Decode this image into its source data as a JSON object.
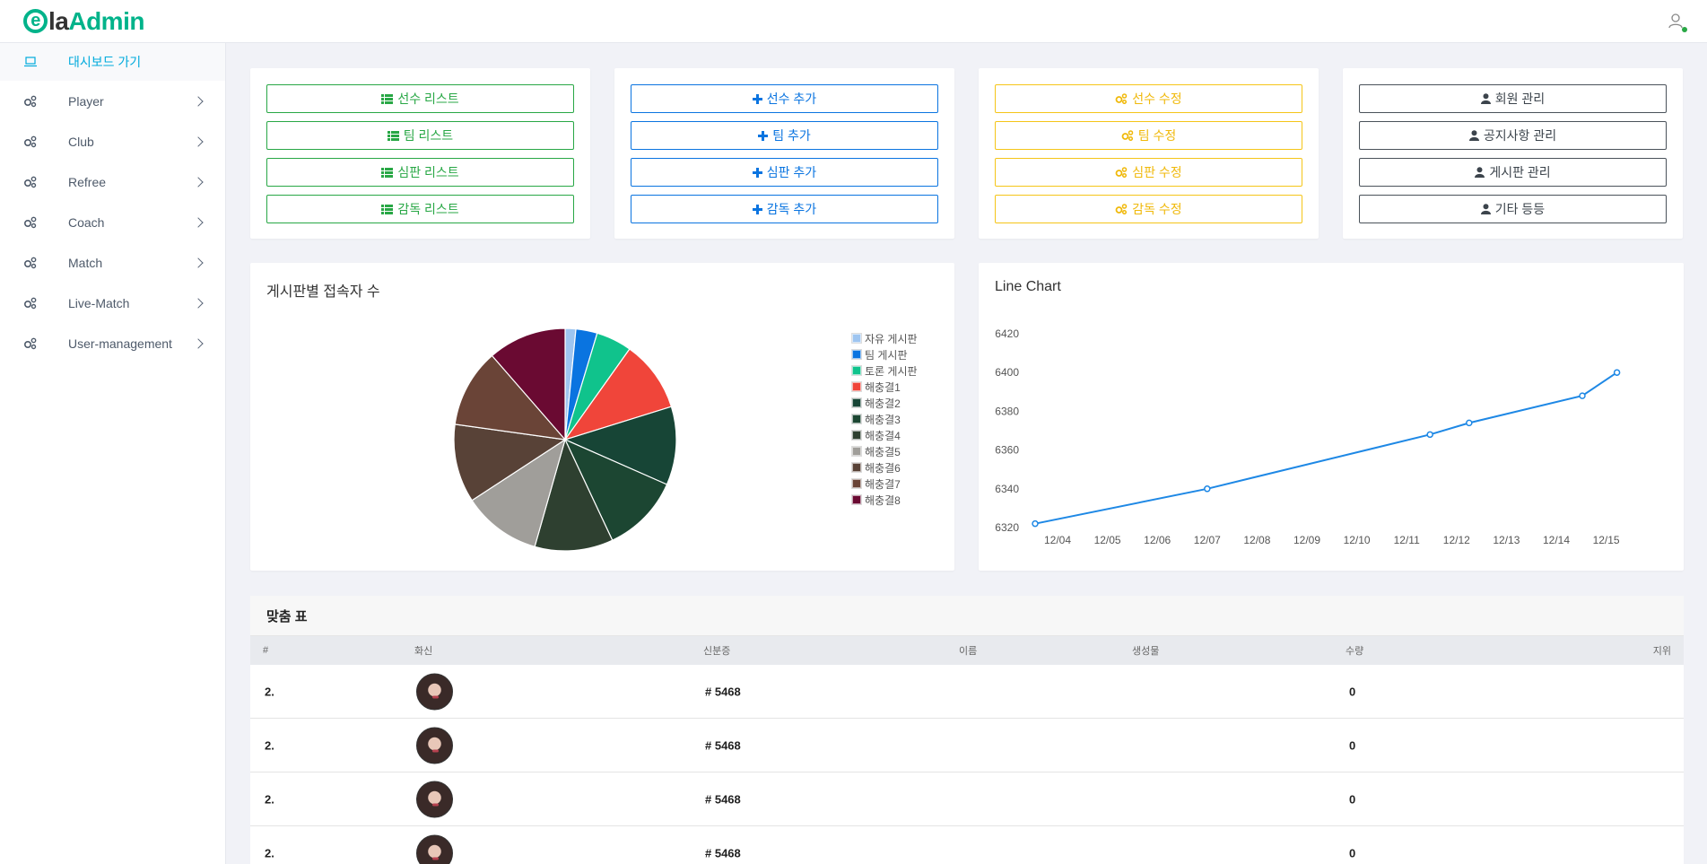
{
  "header": {
    "logo_e": "e",
    "logo_mid": "la",
    "logo_end": "Admin"
  },
  "sidebar": {
    "items": [
      {
        "label": "대시보드 가기",
        "icon": "laptop-icon"
      },
      {
        "label": "Player",
        "icon": "cogs-icon"
      },
      {
        "label": "Club",
        "icon": "cogs-icon"
      },
      {
        "label": "Refree",
        "icon": "cogs-icon"
      },
      {
        "label": "Coach",
        "icon": "cogs-icon"
      },
      {
        "label": "Match",
        "icon": "cogs-icon"
      },
      {
        "label": "Live-Match",
        "icon": "cogs-icon"
      },
      {
        "label": "User-management",
        "icon": "cogs-icon"
      }
    ]
  },
  "actions": {
    "list": [
      "선수 리스트",
      "팀 리스트",
      "심판 리스트",
      "감독 리스트"
    ],
    "add": [
      "선수 추가",
      "팀 추가",
      "심판 추가",
      "감독 추가"
    ],
    "edit": [
      "선수 수정",
      "팀 수정",
      "심판 수정",
      "감독 수정"
    ],
    "manage": [
      "회원 관리",
      "공지사항 관리",
      "게시판 관리",
      "기타 등등"
    ]
  },
  "colors": {
    "green": "#28a745",
    "blue": "#0a74e0",
    "yellow": "#f0b90b",
    "dark": "#3c444c",
    "brand": "#00b38a",
    "line": "#1e88e5"
  },
  "chart_data": [
    {
      "type": "pie",
      "title": "게시판별 접속자 수",
      "categories": [
        "자유 게시판",
        "팀 게시판",
        "토론 게시판",
        "해충결1",
        "해충결2",
        "해충결3",
        "해충결4",
        "해충결5",
        "해충결6",
        "해충결7",
        "해충결8"
      ],
      "values": [
        1.5,
        3,
        5,
        10,
        11,
        11,
        11,
        11,
        11,
        11,
        11
      ],
      "colors": [
        "#9ec5f0",
        "#0a74e0",
        "#10c38c",
        "#f0453a",
        "#174536",
        "#1c4632",
        "#2e4030",
        "#a09e9a",
        "#584237",
        "#6a4437",
        "#6a0a32"
      ],
      "legend": "right"
    },
    {
      "type": "line",
      "title": "Line Chart",
      "categories": [
        "12/04",
        "12/05",
        "12/06",
        "12/07",
        "12/08",
        "12/09",
        "12/10",
        "12/11",
        "12/12",
        "12/13",
        "12/14",
        "12/15"
      ],
      "x": [
        "12/04",
        "12/07",
        "12/11",
        "12/12",
        "12/14",
        "12/15"
      ],
      "values": [
        6322,
        6340,
        6368,
        6374,
        6388,
        6400
      ],
      "ylim": [
        6320,
        6420
      ],
      "yticks": [
        6320,
        6340,
        6360,
        6380,
        6400,
        6420
      ],
      "xlabel": "",
      "ylabel": ""
    }
  ],
  "table": {
    "title": "맞춤 표",
    "columns": [
      "#",
      "화신",
      "신분증",
      "이름",
      "생성물",
      "수량",
      "지위"
    ],
    "rows": [
      {
        "num": "2.",
        "id": "# 5468",
        "qty": "0"
      },
      {
        "num": "2.",
        "id": "# 5468",
        "qty": "0"
      },
      {
        "num": "2.",
        "id": "# 5468",
        "qty": "0"
      },
      {
        "num": "2.",
        "id": "# 5468",
        "qty": "0"
      }
    ]
  }
}
